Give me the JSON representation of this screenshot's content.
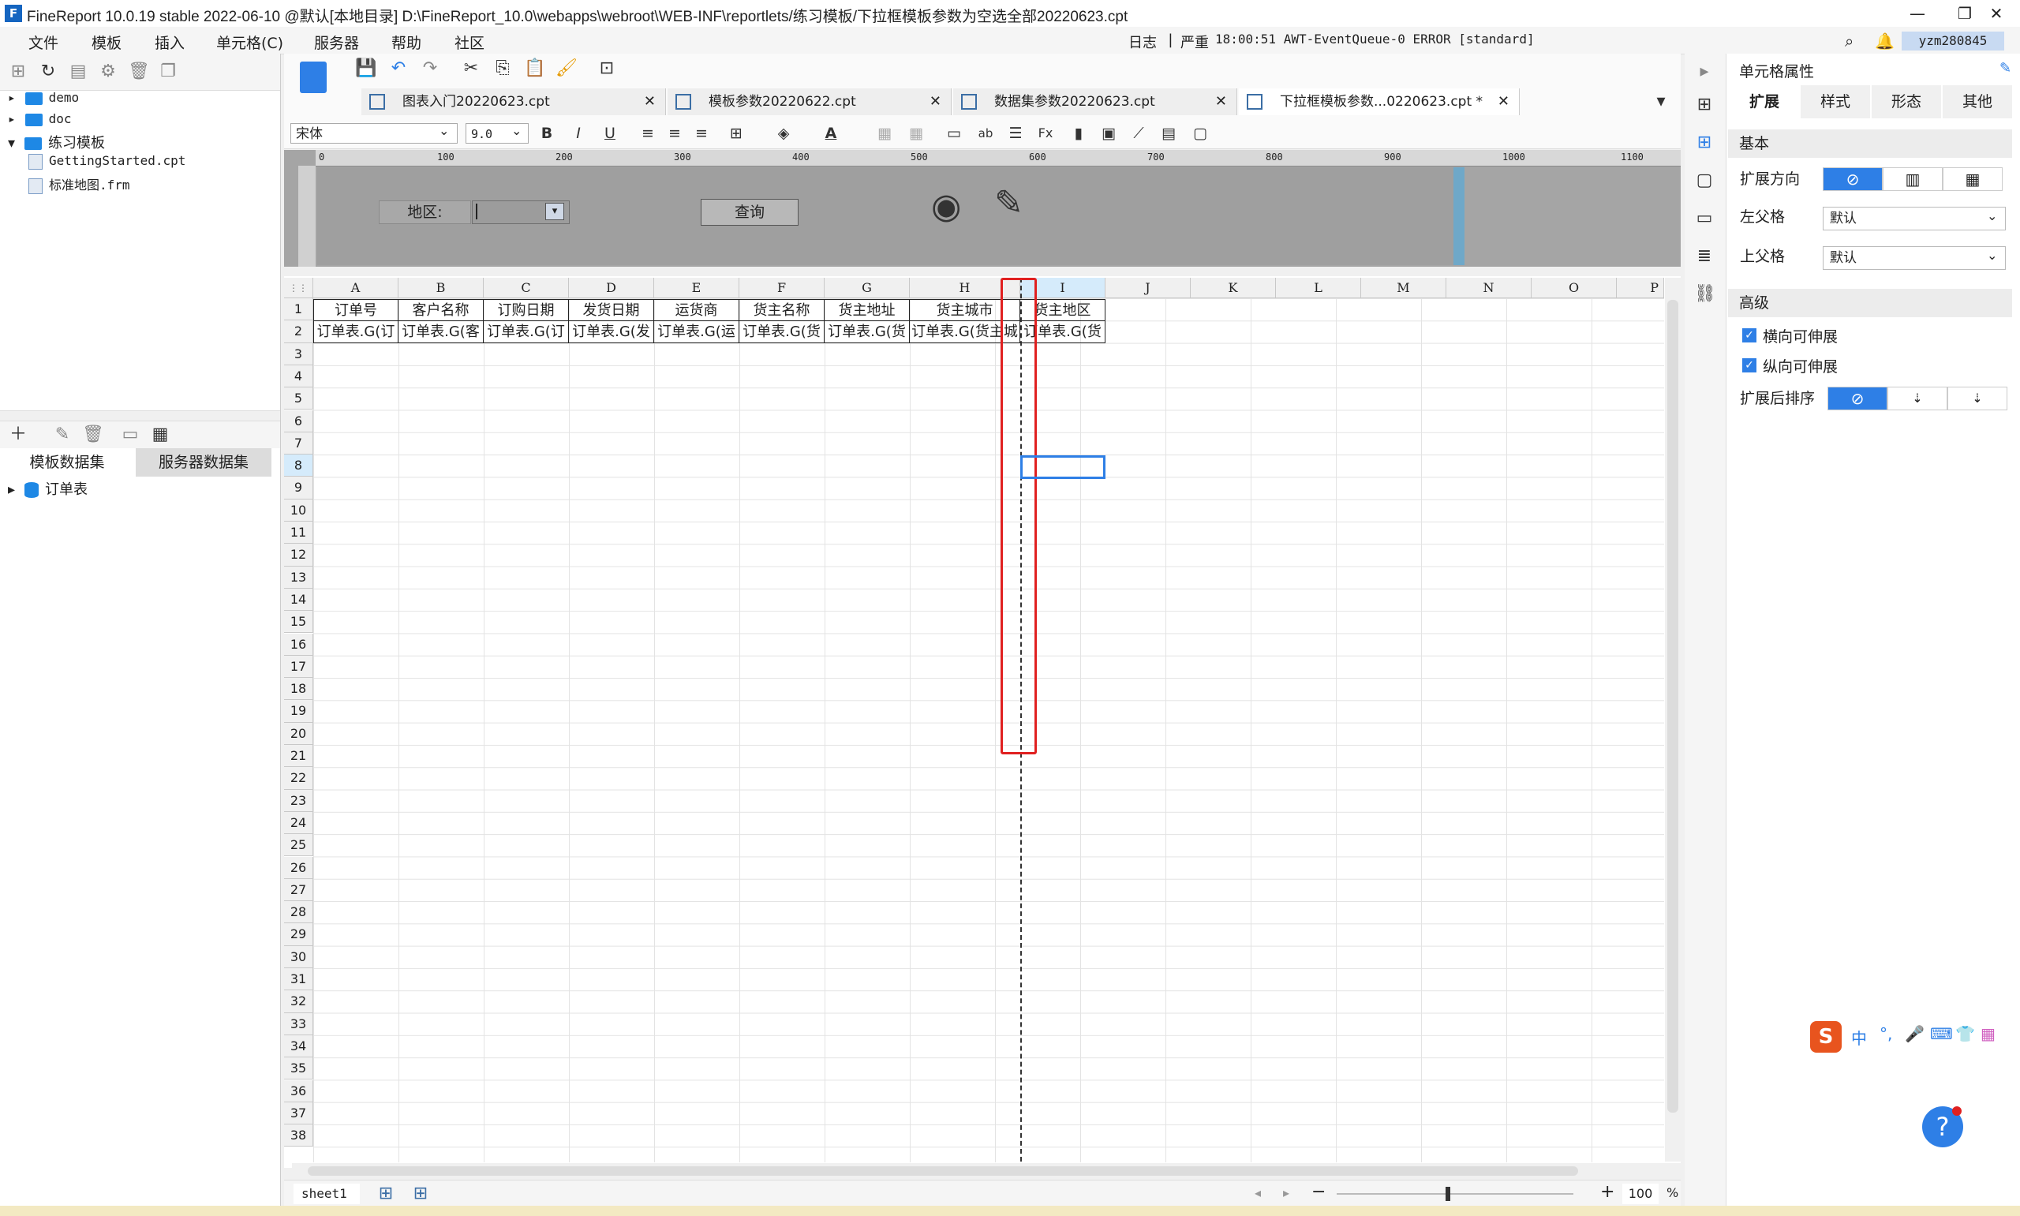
{
  "window": {
    "title": "FineReport 10.0.19 stable 2022-06-10 @默认[本地目录]    D:\\FineReport_10.0\\webapps\\webroot\\WEB-INF\\reportlets/练习模板/下拉框模板参数为空选全部20220623.cpt",
    "minimize": "—",
    "restore": "❐",
    "close": "✕"
  },
  "menu": [
    "文件",
    "模板",
    "插入",
    "单元格(C)",
    "服务器",
    "帮助",
    "社区"
  ],
  "status_top": {
    "log": "日志",
    "severity": "严重",
    "message": "18:00:51 AWT-EventQueue-0 ERROR [standard]",
    "user": "yzm280845"
  },
  "left_tree": [
    {
      "label": "demo",
      "type": "folder"
    },
    {
      "label": "doc",
      "type": "folder"
    },
    {
      "label": "练习模板",
      "type": "folder"
    },
    {
      "label": "GettingStarted.cpt",
      "type": "file"
    },
    {
      "label": "标准地图.frm",
      "type": "file"
    }
  ],
  "dataset_tabs": [
    "模板数据集",
    "服务器数据集"
  ],
  "datasets": [
    "订单表"
  ],
  "tabs": [
    {
      "label": "图表入门20220623.cpt"
    },
    {
      "label": "模板参数20220622.cpt"
    },
    {
      "label": "数据集参数20220623.cpt"
    },
    {
      "label": "下拉框模板参数...0220623.cpt *"
    }
  ],
  "format": {
    "font": "宋体",
    "size": "9.0"
  },
  "ruler_ticks": [
    "0",
    "100",
    "200",
    "300",
    "400",
    "500",
    "600",
    "700",
    "800",
    "900",
    "1000",
    "1100"
  ],
  "param": {
    "label": "地区:",
    "query": "查询"
  },
  "columns": [
    "A",
    "B",
    "C",
    "D",
    "E",
    "F",
    "G",
    "H",
    "I",
    "J",
    "K",
    "L",
    "M",
    "N",
    "O",
    "P"
  ],
  "header_row": [
    "订单号",
    "客户名称",
    "订购日期",
    "发货日期",
    "运货商",
    "货主名称",
    "货主地址",
    "货主城市",
    "货主地区"
  ],
  "data_row": [
    "订单表.G(订",
    "订单表.G(客",
    "订单表.G(订",
    "订单表.G(发",
    "订单表.G(运",
    "订单表.G(货",
    "订单表.G(货",
    "订单表.G(货主城",
    "订单表.G(货"
  ],
  "sheet": {
    "name": "sheet1"
  },
  "zoom": {
    "value": "100",
    "unit": "%"
  },
  "right_panel": {
    "title": "单元格属性",
    "tabs": [
      "扩展",
      "样式",
      "形态",
      "其他"
    ],
    "basic": "基本",
    "expand_dir": "扩展方向",
    "left_parent": "左父格",
    "left_parent_value": "默认",
    "top_parent": "上父格",
    "top_parent_value": "默认",
    "advanced": "高级",
    "h_expand": "横向可伸展",
    "v_expand": "纵向可伸展",
    "sort_after": "扩展后排序"
  },
  "accent_color": "#2e7fe6",
  "highlight_color": "#e02020"
}
